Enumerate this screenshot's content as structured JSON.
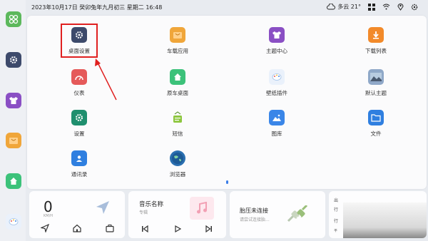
{
  "status_bar": {
    "datetime": "2023年10月17日  癸卯兔年九月初三  星期二  16:48",
    "weather": "多云 21°"
  },
  "sidebar": {
    "items": [
      {
        "icon": "apps-grid-icon",
        "color": "#5cb85c"
      },
      {
        "icon": "gear-icon",
        "color": "#3d4a6b"
      },
      {
        "icon": "shirt-icon",
        "color": "#8a4fc4"
      },
      {
        "icon": "bag-icon",
        "color": "#f0a63a"
      },
      {
        "icon": "home-icon",
        "color": "#3cc27a"
      },
      {
        "icon": "palette-icon",
        "color": "#7ab0e8"
      }
    ]
  },
  "apps": [
    {
      "label": "桌面设置",
      "icon": "gear-icon",
      "color": "#3d4a6b"
    },
    {
      "label": "车载应用",
      "icon": "bag-icon",
      "color": "#f0a63a"
    },
    {
      "label": "主题中心",
      "icon": "shirt-icon",
      "color": "#8a4fc4"
    },
    {
      "label": "下载列表",
      "icon": "download-icon",
      "color": "#f28a2a"
    },
    {
      "label": "仪表",
      "icon": "gauge-icon",
      "color": "#e55a5a"
    },
    {
      "label": "原车桌面",
      "icon": "home-icon",
      "color": "#3cc27a"
    },
    {
      "label": "壁纸插件",
      "icon": "palette-icon",
      "color": "#eaf1fb"
    },
    {
      "label": "默认主题",
      "icon": "landscape-icon",
      "color": "#8fa8c8"
    },
    {
      "label": "设置",
      "icon": "gear-icon",
      "color": "#1f8f6e"
    },
    {
      "label": "短信",
      "icon": "message-icon",
      "color": "#8dc63f"
    },
    {
      "label": "图库",
      "icon": "picture-icon",
      "color": "#3a86e8"
    },
    {
      "label": "文件",
      "icon": "folder-icon",
      "color": "#2f7fe0"
    },
    {
      "label": "通讯录",
      "icon": "contacts-icon",
      "color": "#2f7fe0"
    },
    {
      "label": "浏览器",
      "icon": "globe-icon",
      "color": "#2a6fb0"
    }
  ],
  "speed_card": {
    "value": "0",
    "unit": "KM/H"
  },
  "music_card": {
    "title": "音乐名称",
    "subtitle": "专辑"
  },
  "bt_card": {
    "title": "胎压未连接",
    "subtitle": "请尝试连接胎..."
  },
  "trip_card": {
    "line1": "出",
    "line2": "行",
    "line3": "行",
    "line4": "平"
  }
}
